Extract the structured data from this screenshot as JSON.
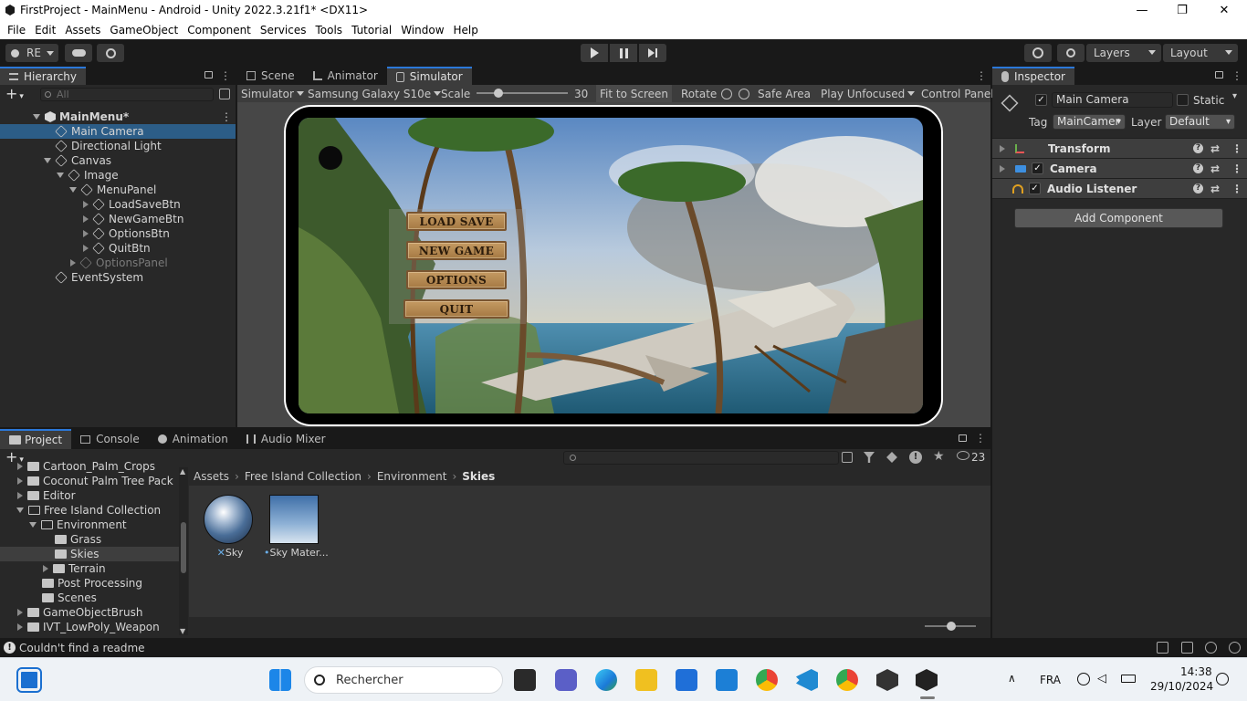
{
  "window": {
    "title": "FirstProject - MainMenu - Android - Unity 2022.3.21f1* <DX11>",
    "minimize": "—",
    "restore": "❐",
    "close": "✕"
  },
  "menubar": [
    "File",
    "Edit",
    "Assets",
    "GameObject",
    "Component",
    "Services",
    "Tools",
    "Tutorial",
    "Window",
    "Help"
  ],
  "toolbar": {
    "account": "RE",
    "layers": "Layers",
    "layout": "Layout"
  },
  "hierarchy": {
    "tab": "Hierarchy",
    "search_placeholder": "All",
    "items": [
      {
        "label": "MainMenu*",
        "depth": 0
      },
      {
        "label": "Main Camera",
        "depth": 1
      },
      {
        "label": "Directional Light",
        "depth": 1
      },
      {
        "label": "Canvas",
        "depth": 1
      },
      {
        "label": "Image",
        "depth": 2
      },
      {
        "label": "MenuPanel",
        "depth": 3
      },
      {
        "label": "LoadSaveBtn",
        "depth": 4
      },
      {
        "label": "NewGameBtn",
        "depth": 4
      },
      {
        "label": "OptionsBtn",
        "depth": 4
      },
      {
        "label": "QuitBtn",
        "depth": 4
      },
      {
        "label": "OptionsPanel",
        "depth": 3
      },
      {
        "label": "EventSystem",
        "depth": 1
      }
    ]
  },
  "center_tabs": [
    "Scene",
    "Animator",
    "Simulator"
  ],
  "simulator": {
    "mode": "Simulator",
    "device": "Samsung Galaxy S10e",
    "scale_label": "Scale",
    "scale_value": "30",
    "fit": "Fit to Screen",
    "rotate": "Rotate",
    "safe_area": "Safe Area",
    "play_mode": "Play Unfocused",
    "control_panel": "Control Panel"
  },
  "game_menu": {
    "buttons": [
      "LOAD SAVE",
      "NEW GAME",
      "OPTIONS",
      "QUIT"
    ]
  },
  "inspector": {
    "tab": "Inspector",
    "object_name": "Main Camera",
    "static_label": "Static",
    "tag_label": "Tag",
    "tag_value": "MainCamer",
    "layer_label": "Layer",
    "layer_value": "Default",
    "components": [
      "Transform",
      "Camera",
      "Audio Listener"
    ],
    "add_component": "Add Component"
  },
  "bottom_tabs": [
    "Project",
    "Console",
    "Animation",
    "Audio Mixer"
  ],
  "project": {
    "hidden_count": "23",
    "breadcrumb": [
      "Assets",
      "Free Island Collection",
      "Environment",
      "Skies"
    ],
    "tree": [
      {
        "label": "Cartoon_Palm_Crops",
        "depth": 0
      },
      {
        "label": "Coconut Palm Tree Pack",
        "depth": 0
      },
      {
        "label": "Editor",
        "depth": 0
      },
      {
        "label": "Free Island Collection",
        "depth": 0
      },
      {
        "label": "Environment",
        "depth": 1
      },
      {
        "label": "Grass",
        "depth": 2
      },
      {
        "label": "Skies",
        "depth": 2
      },
      {
        "label": "Terrain",
        "depth": 2
      },
      {
        "label": "Post Processing",
        "depth": 1
      },
      {
        "label": "Scenes",
        "depth": 1
      },
      {
        "label": "GameObjectBrush",
        "depth": 0
      },
      {
        "label": "IVT_LowPoly_Weapon",
        "depth": 0
      }
    ],
    "assets": [
      {
        "label": "Sky"
      },
      {
        "label": "Sky Mater..."
      }
    ]
  },
  "status": {
    "message": "Couldn't find a readme"
  },
  "taskbar": {
    "search_placeholder": "Rechercher",
    "language": "FRA",
    "time": "14:38",
    "date": "29/10/2024"
  }
}
